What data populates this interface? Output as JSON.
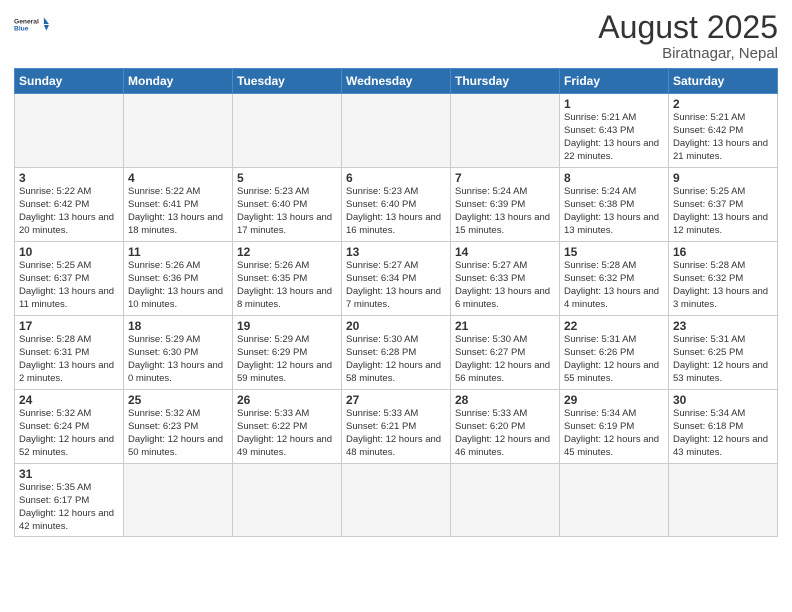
{
  "header": {
    "logo_general": "General",
    "logo_blue": "Blue",
    "month_year": "August 2025",
    "location": "Biratnagar, Nepal"
  },
  "weekdays": [
    "Sunday",
    "Monday",
    "Tuesday",
    "Wednesday",
    "Thursday",
    "Friday",
    "Saturday"
  ],
  "days": {
    "1": {
      "sunrise": "5:21 AM",
      "sunset": "6:43 PM",
      "daylight": "13 hours and 22 minutes."
    },
    "2": {
      "sunrise": "5:21 AM",
      "sunset": "6:42 PM",
      "daylight": "13 hours and 21 minutes."
    },
    "3": {
      "sunrise": "5:22 AM",
      "sunset": "6:42 PM",
      "daylight": "13 hours and 20 minutes."
    },
    "4": {
      "sunrise": "5:22 AM",
      "sunset": "6:41 PM",
      "daylight": "13 hours and 18 minutes."
    },
    "5": {
      "sunrise": "5:23 AM",
      "sunset": "6:40 PM",
      "daylight": "13 hours and 17 minutes."
    },
    "6": {
      "sunrise": "5:23 AM",
      "sunset": "6:40 PM",
      "daylight": "13 hours and 16 minutes."
    },
    "7": {
      "sunrise": "5:24 AM",
      "sunset": "6:39 PM",
      "daylight": "13 hours and 15 minutes."
    },
    "8": {
      "sunrise": "5:24 AM",
      "sunset": "6:38 PM",
      "daylight": "13 hours and 13 minutes."
    },
    "9": {
      "sunrise": "5:25 AM",
      "sunset": "6:37 PM",
      "daylight": "13 hours and 12 minutes."
    },
    "10": {
      "sunrise": "5:25 AM",
      "sunset": "6:37 PM",
      "daylight": "13 hours and 11 minutes."
    },
    "11": {
      "sunrise": "5:26 AM",
      "sunset": "6:36 PM",
      "daylight": "13 hours and 10 minutes."
    },
    "12": {
      "sunrise": "5:26 AM",
      "sunset": "6:35 PM",
      "daylight": "13 hours and 8 minutes."
    },
    "13": {
      "sunrise": "5:27 AM",
      "sunset": "6:34 PM",
      "daylight": "13 hours and 7 minutes."
    },
    "14": {
      "sunrise": "5:27 AM",
      "sunset": "6:33 PM",
      "daylight": "13 hours and 6 minutes."
    },
    "15": {
      "sunrise": "5:28 AM",
      "sunset": "6:32 PM",
      "daylight": "13 hours and 4 minutes."
    },
    "16": {
      "sunrise": "5:28 AM",
      "sunset": "6:32 PM",
      "daylight": "13 hours and 3 minutes."
    },
    "17": {
      "sunrise": "5:28 AM",
      "sunset": "6:31 PM",
      "daylight": "13 hours and 2 minutes."
    },
    "18": {
      "sunrise": "5:29 AM",
      "sunset": "6:30 PM",
      "daylight": "13 hours and 0 minutes."
    },
    "19": {
      "sunrise": "5:29 AM",
      "sunset": "6:29 PM",
      "daylight": "12 hours and 59 minutes."
    },
    "20": {
      "sunrise": "5:30 AM",
      "sunset": "6:28 PM",
      "daylight": "12 hours and 58 minutes."
    },
    "21": {
      "sunrise": "5:30 AM",
      "sunset": "6:27 PM",
      "daylight": "12 hours and 56 minutes."
    },
    "22": {
      "sunrise": "5:31 AM",
      "sunset": "6:26 PM",
      "daylight": "12 hours and 55 minutes."
    },
    "23": {
      "sunrise": "5:31 AM",
      "sunset": "6:25 PM",
      "daylight": "12 hours and 53 minutes."
    },
    "24": {
      "sunrise": "5:32 AM",
      "sunset": "6:24 PM",
      "daylight": "12 hours and 52 minutes."
    },
    "25": {
      "sunrise": "5:32 AM",
      "sunset": "6:23 PM",
      "daylight": "12 hours and 50 minutes."
    },
    "26": {
      "sunrise": "5:33 AM",
      "sunset": "6:22 PM",
      "daylight": "12 hours and 49 minutes."
    },
    "27": {
      "sunrise": "5:33 AM",
      "sunset": "6:21 PM",
      "daylight": "12 hours and 48 minutes."
    },
    "28": {
      "sunrise": "5:33 AM",
      "sunset": "6:20 PM",
      "daylight": "12 hours and 46 minutes."
    },
    "29": {
      "sunrise": "5:34 AM",
      "sunset": "6:19 PM",
      "daylight": "12 hours and 45 minutes."
    },
    "30": {
      "sunrise": "5:34 AM",
      "sunset": "6:18 PM",
      "daylight": "12 hours and 43 minutes."
    },
    "31": {
      "sunrise": "5:35 AM",
      "sunset": "6:17 PM",
      "daylight": "12 hours and 42 minutes."
    }
  }
}
